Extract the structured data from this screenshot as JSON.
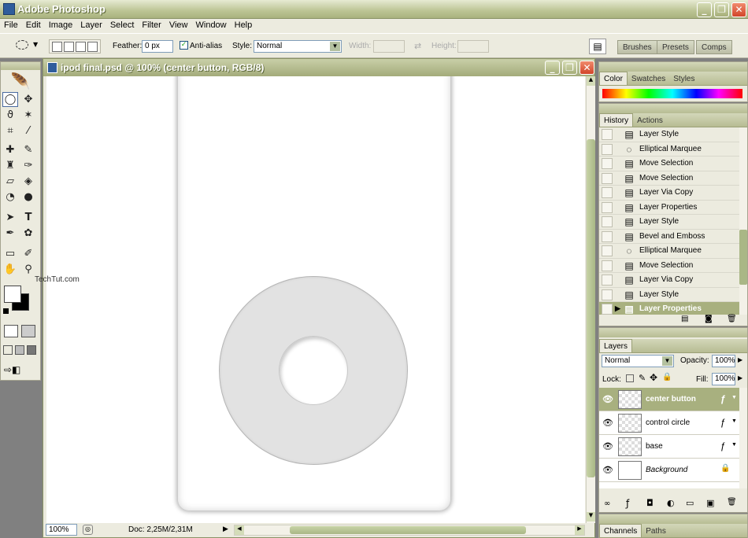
{
  "app": {
    "title": "Adobe Photoshop",
    "window_controls": {
      "minimize": "_",
      "restore": "❐",
      "close": "✕"
    }
  },
  "menu": [
    "File",
    "Edit",
    "Image",
    "Layer",
    "Select",
    "Filter",
    "View",
    "Window",
    "Help"
  ],
  "options_bar": {
    "feather_label": "Feather:",
    "feather_value": "0 px",
    "antialias_label": "Anti-alias",
    "antialias_checked": true,
    "style_label": "Style:",
    "style_value": "Normal",
    "width_label": "Width:",
    "height_label": "Height:",
    "dock_tabs": [
      "Brushes",
      "Presets",
      "Comps"
    ]
  },
  "document": {
    "title": "ipod final.psd @ 100% (center button, RGB/8)",
    "zoom": "100%",
    "doc_info": "Doc: 2,25M/2,31M"
  },
  "watermark": {
    "text": "TechTut.com"
  },
  "color_panel": {
    "tabs": [
      "Color",
      "Swatches",
      "Styles"
    ]
  },
  "history_panel": {
    "tabs": [
      "History",
      "Actions"
    ],
    "items": [
      {
        "label": "Layer Style",
        "icon": "doc-icon"
      },
      {
        "label": "Elliptical Marquee",
        "icon": "ellipse-icon"
      },
      {
        "label": "Move Selection",
        "icon": "doc-icon"
      },
      {
        "label": "Move Selection",
        "icon": "doc-icon"
      },
      {
        "label": "Layer Via Copy",
        "icon": "doc-icon"
      },
      {
        "label": "Layer Properties",
        "icon": "doc-icon"
      },
      {
        "label": "Layer Style",
        "icon": "doc-icon"
      },
      {
        "label": "Bevel and Emboss",
        "icon": "doc-icon"
      },
      {
        "label": "Elliptical Marquee",
        "icon": "ellipse-icon"
      },
      {
        "label": "Move Selection",
        "icon": "doc-icon"
      },
      {
        "label": "Layer Via Copy",
        "icon": "doc-icon"
      },
      {
        "label": "Layer Style",
        "icon": "doc-icon"
      },
      {
        "label": "Layer Properties",
        "icon": "doc-icon",
        "current": true
      }
    ]
  },
  "layers_panel": {
    "tab": "Layers",
    "blend_mode": "Normal",
    "opacity_label": "Opacity:",
    "opacity_value": "100%",
    "lock_label": "Lock:",
    "fill_label": "Fill:",
    "fill_value": "100%",
    "layers": [
      {
        "name": "center button",
        "selected": true,
        "fx": true,
        "locked": false
      },
      {
        "name": "control circle",
        "selected": false,
        "fx": true,
        "locked": false
      },
      {
        "name": "base",
        "selected": false,
        "fx": true,
        "locked": false
      },
      {
        "name": "Background",
        "selected": false,
        "fx": false,
        "locked": true
      }
    ]
  },
  "bottom_panel": {
    "tabs": [
      "Channels",
      "Paths"
    ]
  },
  "colors": {
    "accent_olive": "#a8b07f",
    "panel_bg": "#ecebdf"
  }
}
